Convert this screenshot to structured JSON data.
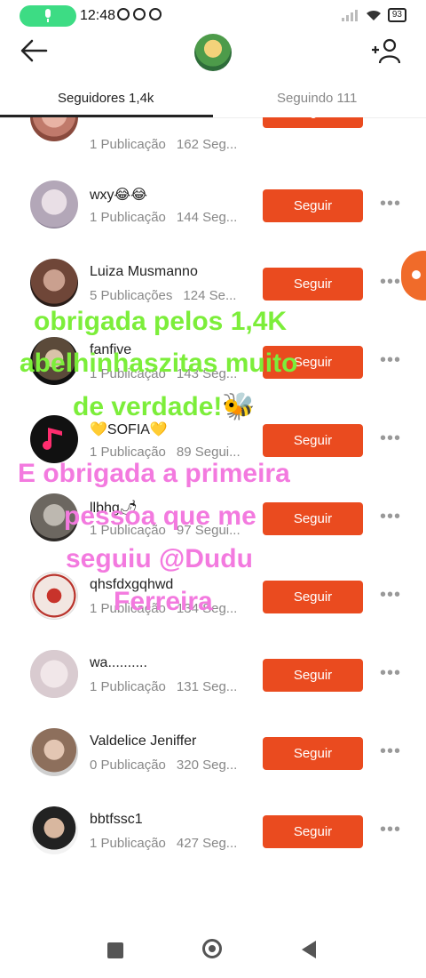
{
  "status_bar": {
    "time": "12:48",
    "battery": "93"
  },
  "tabs": [
    {
      "label": "Seguidores 1,4k",
      "active": true
    },
    {
      "label": "Seguindo 111",
      "active": false
    }
  ],
  "follow_label": "Seguir",
  "more_label": "•••",
  "rows": [
    {
      "name": "",
      "publications": "1 Publicação",
      "following": "162 Seg..."
    },
    {
      "name": "wxy😂😂",
      "publications": "1 Publicação",
      "following": "144 Seg..."
    },
    {
      "name": "Luiza Musmanno",
      "publications": "5 Publicações",
      "following": "124 Se..."
    },
    {
      "name": "fanfive",
      "publications": "1 Publicação",
      "following": "143 Seg..."
    },
    {
      "name": "💛SOFIA💛",
      "publications": "1 Publicação",
      "following": "89 Segui..."
    },
    {
      "name": "llbhg🌶",
      "publications": "1 Publicação",
      "following": "97 Segui..."
    },
    {
      "name": "qhsfdxgqhwd",
      "publications": "1 Publicação",
      "following": "134 Seg..."
    },
    {
      "name": "wa..........",
      "publications": "1 Publicação",
      "following": "131 Seg..."
    },
    {
      "name": "Valdelice Jeniffer",
      "publications": "0 Publicação",
      "following": "320 Seg..."
    },
    {
      "name": "bbtfssc1",
      "publications": "1 Publicação",
      "following": "427 Seg..."
    }
  ],
  "captions": {
    "green_1": "obrigada pelos 1,4K",
    "green_2": "abelhinhaszitas muito",
    "green_3": "de verdade!🐝",
    "pink_1": "E obrigada  a primeira",
    "pink_2": "pessoa que me",
    "pink_3": "seguiu @Dudu",
    "pink_4": "Ferreira"
  },
  "colors": {
    "follow_button": "#ea4b1f",
    "caption_green": "#7cee3a",
    "caption_pink": "#f37adf"
  }
}
